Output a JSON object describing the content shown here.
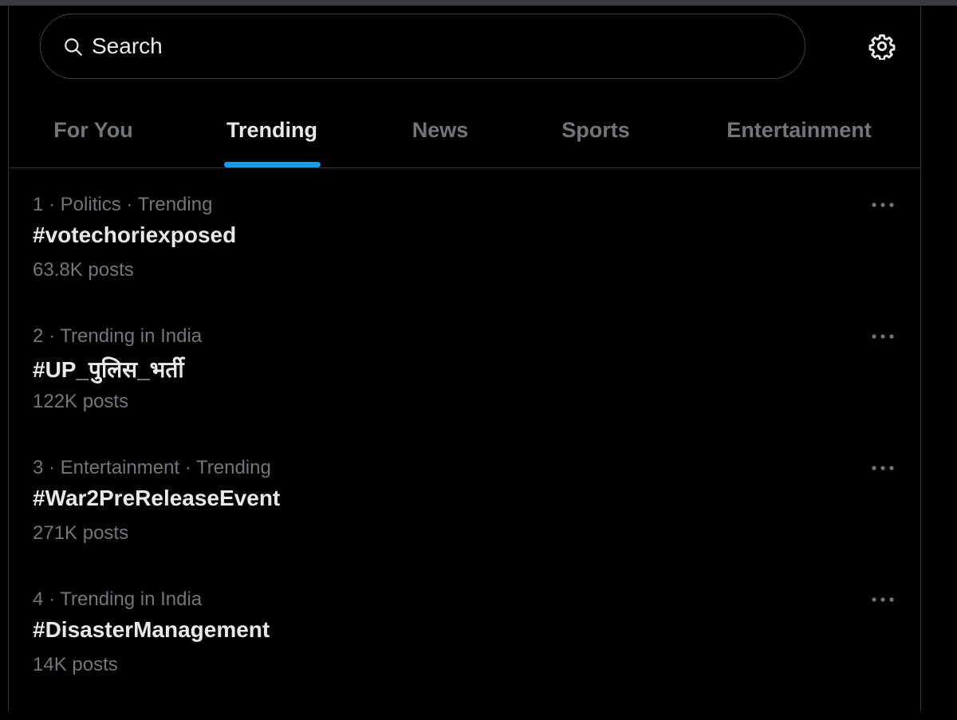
{
  "search": {
    "placeholder": "Search"
  },
  "icons": {
    "search": "search-icon",
    "settings": "gear-icon",
    "more": "more-horizontal-icon"
  },
  "colors": {
    "background": "#000000",
    "text_primary": "#e7e9ea",
    "text_secondary": "#71767b",
    "accent": "#1d9bf0",
    "divider": "#2f3336"
  },
  "tabs": [
    {
      "label": "For You",
      "active": false
    },
    {
      "label": "Trending",
      "active": true
    },
    {
      "label": "News",
      "active": false
    },
    {
      "label": "Sports",
      "active": false
    },
    {
      "label": "Entertainment",
      "active": false
    }
  ],
  "trends": [
    {
      "meta": "1 · Politics · Trending",
      "title": "#votechoriexposed",
      "count": "63.8K posts"
    },
    {
      "meta": "2 · Trending in India",
      "title": "#UP_पुलिस_भर्ती",
      "count": "122K posts"
    },
    {
      "meta": "3 · Entertainment · Trending",
      "title": "#War2PreReleaseEvent",
      "count": "271K posts"
    },
    {
      "meta": "4 · Trending in India",
      "title": "#DisasterManagement",
      "count": "14K posts"
    }
  ]
}
